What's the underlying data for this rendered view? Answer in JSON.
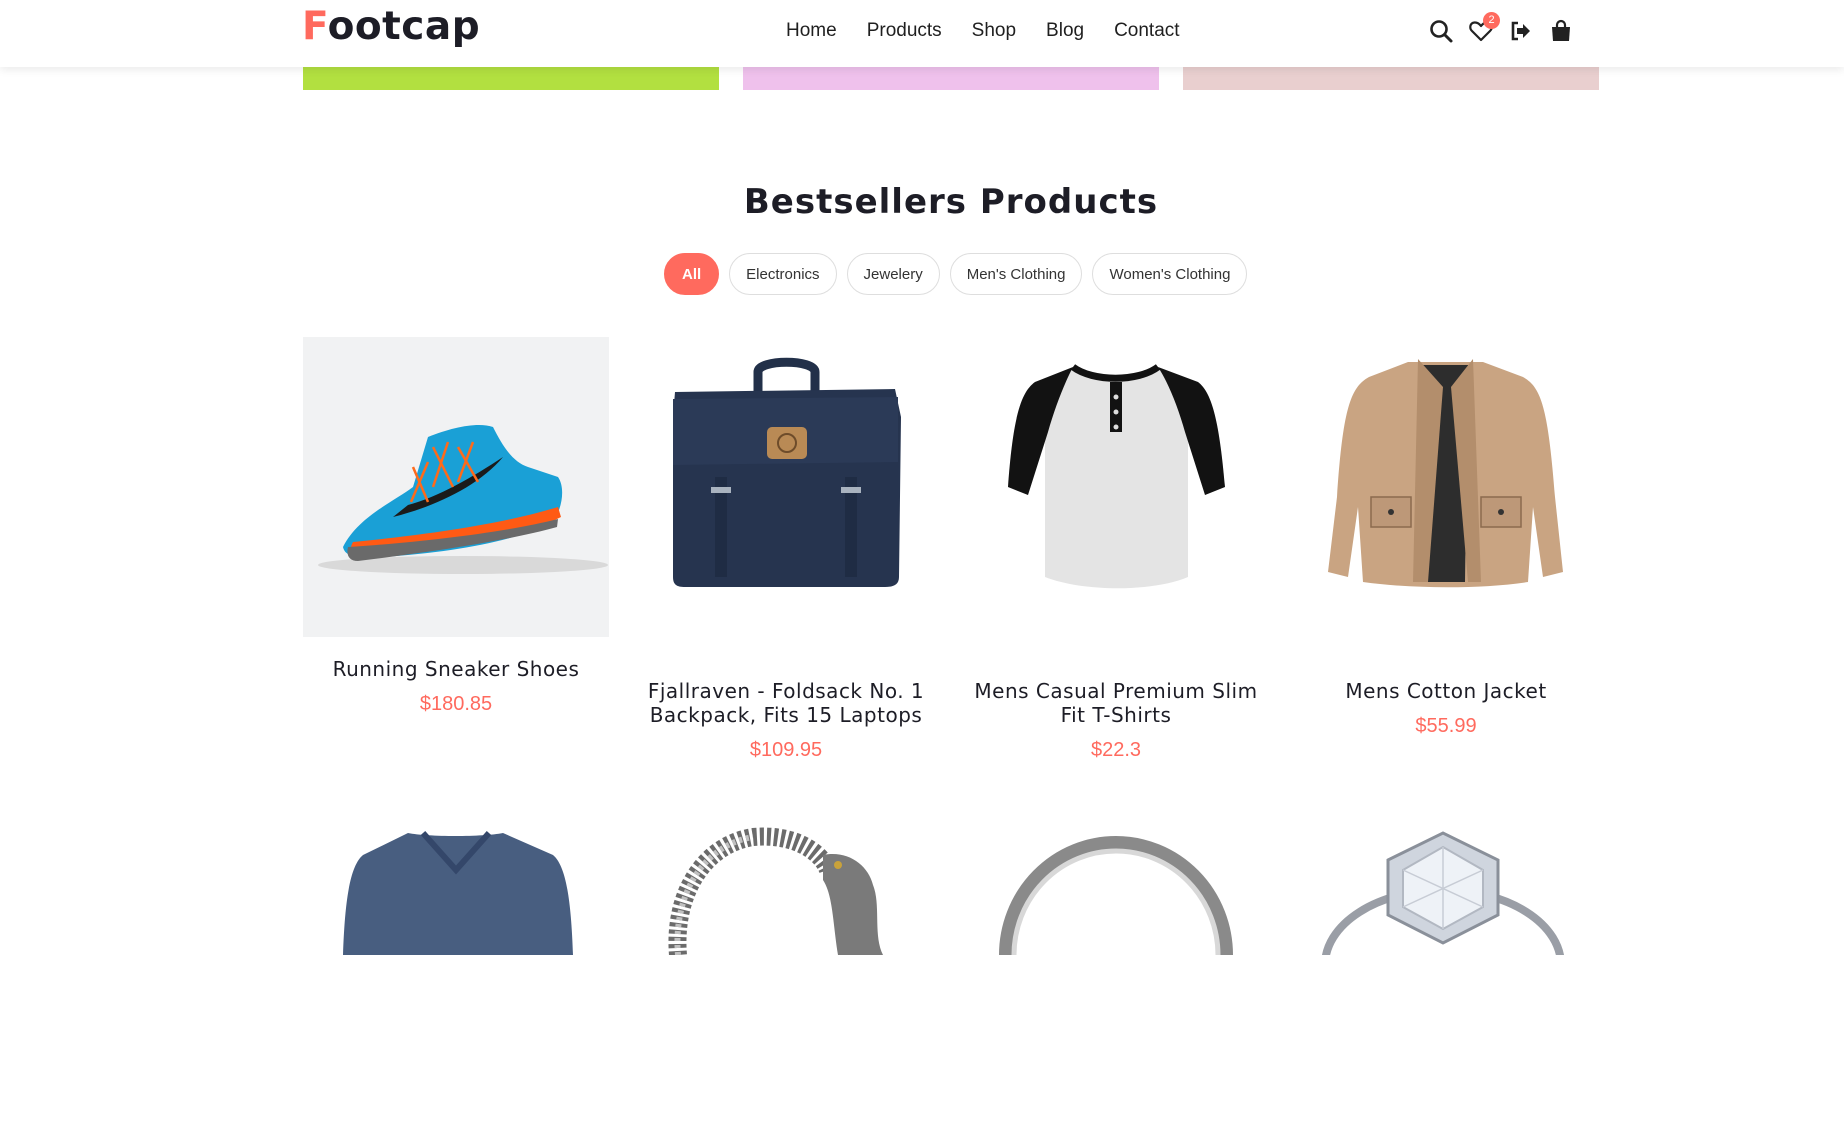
{
  "brand": {
    "first": "F",
    "rest": "ootcap",
    "accent": "#ff6a5e"
  },
  "nav": [
    "Home",
    "Products",
    "Shop",
    "Blog",
    "Contact"
  ],
  "header_icons": {
    "search": "search-icon",
    "wishlist": "heart-icon",
    "wishlist_count": "2",
    "login": "sign-in-icon",
    "cart": "shopping-bag-icon"
  },
  "strip_colors": [
    "#b2e040",
    "#efc1ec",
    "#e9cfcf"
  ],
  "section": {
    "title": "Bestsellers Products"
  },
  "filters": [
    "All",
    "Electronics",
    "Jewelery",
    "Men's Clothing",
    "Women's Clothing"
  ],
  "active_filter": "All",
  "products": [
    {
      "name": "Running Sneaker Shoes",
      "price": "$180.85",
      "image": "sneaker-image"
    },
    {
      "name": "Fjallraven - Foldsack No. 1 Backpack, Fits 15 Laptops",
      "price": "$109.95",
      "image": "backpack-image"
    },
    {
      "name": "Mens Casual Premium Slim Fit T-Shirts",
      "price": "$22.3",
      "image": "henley-tshirt-image"
    },
    {
      "name": "Mens Cotton Jacket",
      "price": "$55.99",
      "image": "jacket-image"
    }
  ],
  "products_row2_images": [
    "vneck-sweater-image",
    "dragon-bracelet-image",
    "silver-ring-image",
    "diamond-ring-image"
  ]
}
